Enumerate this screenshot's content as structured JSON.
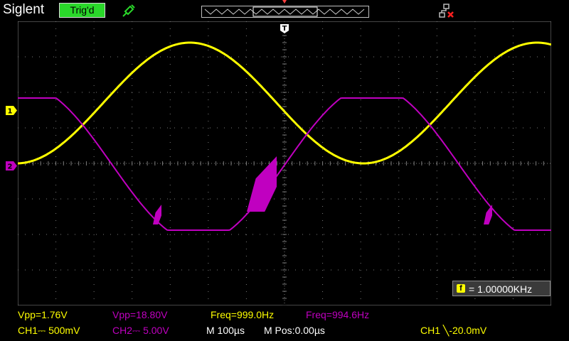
{
  "header": {
    "brand": "Siglent",
    "trigger_status": "Trig'd"
  },
  "markers": {
    "trigger": "T",
    "ch1": "1",
    "ch2": "2",
    "trigger_point": "T"
  },
  "colors": {
    "ch1": "#ffff00",
    "ch2": "#c000c0",
    "trigger_status_bg": "#2ad82a",
    "grid": "#7a7a7a",
    "background": "#000000"
  },
  "icons": {
    "probe": "probe-icon",
    "network": "network-disconnected-icon",
    "frequency": "frequency-counter-icon"
  },
  "frequency_counter": {
    "icon_label": "f",
    "text": "= 1.00000KHz"
  },
  "measurements": {
    "ch1_vpp": "Vpp=1.76V",
    "ch2_vpp": "Vpp=18.80V",
    "ch1_freq": "Freq=999.0Hz",
    "ch2_freq": "Freq=994.6Hz"
  },
  "status": {
    "ch1_scale": "CH1⎓ 500mV",
    "ch2_scale": "CH2⎓ 5.00V",
    "timebase": "M 100µs",
    "position": "M Pos:0.00µs",
    "trigger_info": "CH1 ╲-20.0mV"
  }
}
